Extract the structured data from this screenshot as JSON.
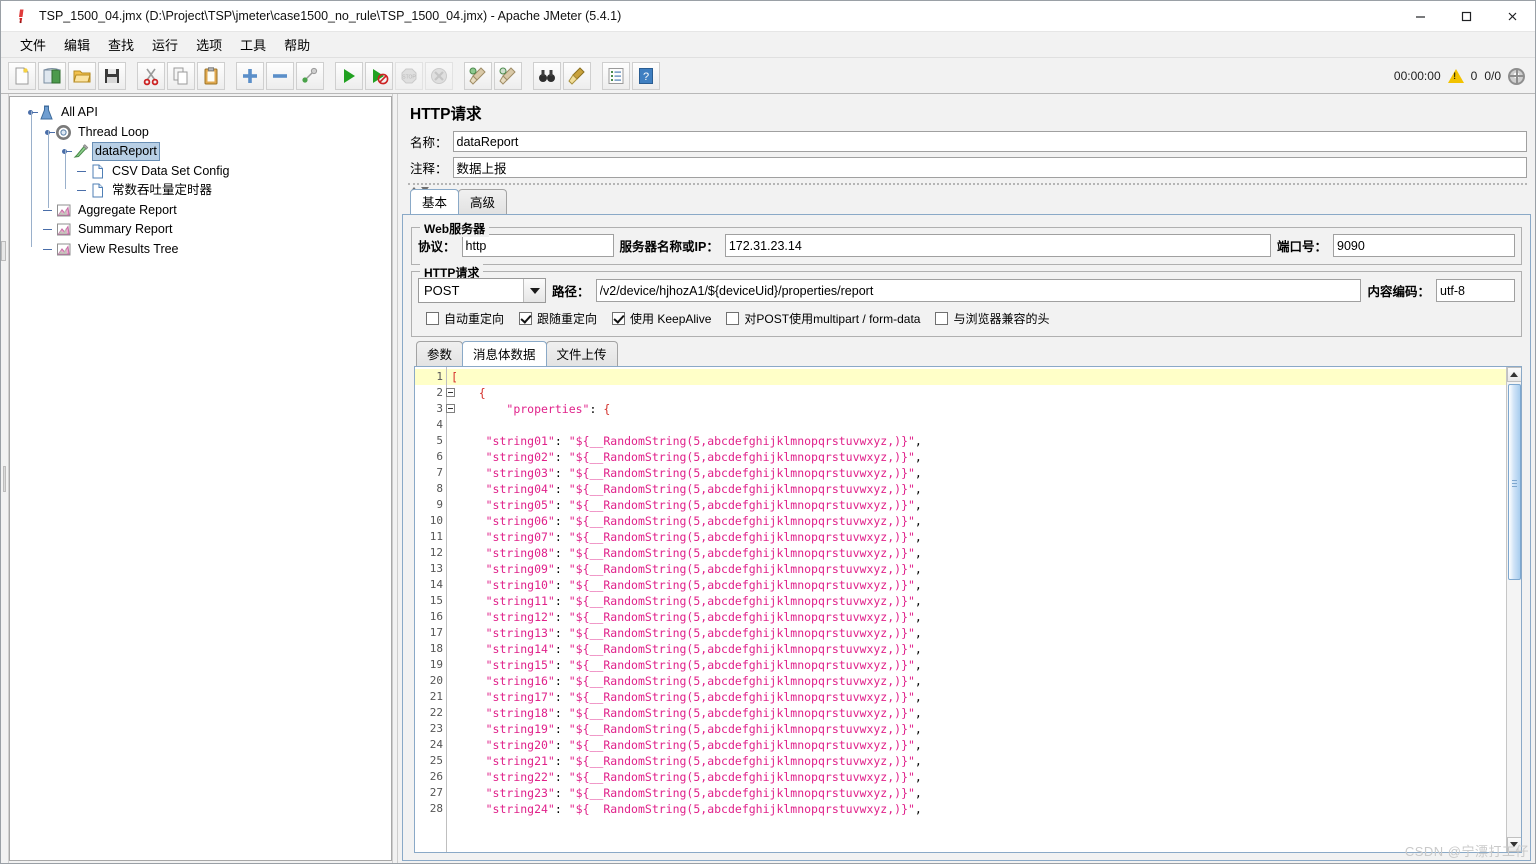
{
  "window": {
    "title": "TSP_1500_04.jmx (D:\\Project\\TSP\\jmeter\\case1500_no_rule\\TSP_1500_04.jmx) - Apache JMeter (5.4.1)",
    "minimize": "—",
    "maximize": "□",
    "close": "✕"
  },
  "menu": [
    "文件",
    "编辑",
    "查找",
    "运行",
    "选项",
    "工具",
    "帮助"
  ],
  "toolbar": {
    "buttons": [
      {
        "name": "new-button",
        "icon": "new-file-icon"
      },
      {
        "name": "templates-button",
        "icon": "templates-icon"
      },
      {
        "name": "open-button",
        "icon": "open-folder-icon"
      },
      {
        "name": "save-button",
        "icon": "save-disk-icon"
      },
      {
        "name": "cut-button",
        "icon": "scissors-icon"
      },
      {
        "name": "copy-button",
        "icon": "copy-icon"
      },
      {
        "name": "paste-button",
        "icon": "clipboard-icon"
      },
      {
        "name": "expand-all-button",
        "icon": "plus-icon"
      },
      {
        "name": "collapse-all-button",
        "icon": "minus-icon"
      },
      {
        "name": "toggle-button",
        "icon": "toggle-icon"
      },
      {
        "name": "start-button",
        "icon": "play-green-icon"
      },
      {
        "name": "start-no-pauses-button",
        "icon": "play-no-pause-icon"
      },
      {
        "name": "stop-button",
        "icon": "stop-sign-icon"
      },
      {
        "name": "shutdown-button",
        "icon": "shutdown-icon"
      },
      {
        "name": "clear-button",
        "icon": "broom-icon"
      },
      {
        "name": "clear-all-button",
        "icon": "broom-all-icon"
      },
      {
        "name": "search-button",
        "icon": "binoculars-icon"
      },
      {
        "name": "reset-search-button",
        "icon": "reset-broom-icon"
      },
      {
        "name": "function-helper-button",
        "icon": "function-list-icon"
      },
      {
        "name": "help-button",
        "icon": "help-book-icon"
      }
    ],
    "elapsed_time": "00:00:00",
    "warning_count": "0",
    "threads_count": "0/0"
  },
  "tree": {
    "nodes": [
      {
        "label": "All API",
        "icon": "test-plan-icon",
        "depth": 0,
        "selected": false,
        "has_handle": true
      },
      {
        "label": "Thread Loop",
        "icon": "thread-group-icon",
        "depth": 1,
        "selected": false,
        "has_handle": true
      },
      {
        "label": "dataReport",
        "icon": "http-sampler-icon",
        "depth": 2,
        "selected": true,
        "has_handle": true
      },
      {
        "label": "CSV Data Set Config",
        "icon": "config-element-icon",
        "depth": 3,
        "selected": false,
        "has_handle": false
      },
      {
        "label": "常数吞吐量定时器",
        "icon": "timer-icon",
        "depth": 3,
        "selected": false,
        "has_handle": false
      },
      {
        "label": "Aggregate Report",
        "icon": "listener-icon",
        "depth": 1,
        "selected": false,
        "has_handle": false
      },
      {
        "label": "Summary Report",
        "icon": "listener-icon",
        "depth": 1,
        "selected": false,
        "has_handle": false
      },
      {
        "label": "View Results Tree",
        "icon": "listener-icon",
        "depth": 1,
        "selected": false,
        "has_handle": false
      }
    ]
  },
  "panel": {
    "title": "HTTP请求",
    "name_label": "名称：",
    "name_value": "dataReport",
    "comment_label": "注释：",
    "comment_value": "数据上报",
    "tabs": [
      {
        "label": "基本",
        "active": true
      },
      {
        "label": "高级",
        "active": false
      }
    ],
    "web_server": {
      "group_title": "Web服务器",
      "protocol_label": "协议：",
      "protocol_value": "http",
      "server_label": "服务器名称或IP：",
      "server_value": "172.31.23.14",
      "port_label": "端口号：",
      "port_value": "9090"
    },
    "http_request": {
      "group_title": "HTTP请求",
      "method_value": "POST",
      "path_label": "路径：",
      "path_value": "/v2/device/hjhozA1/${deviceUid}/properties/report",
      "encoding_label": "内容编码：",
      "encoding_value": "utf-8",
      "checkboxes": [
        {
          "label": "自动重定向",
          "checked": false
        },
        {
          "label": "跟随重定向",
          "checked": true
        },
        {
          "label": "使用 KeepAlive",
          "checked": true
        },
        {
          "label": "对POST使用multipart / form-data",
          "checked": false
        },
        {
          "label": "与浏览器兼容的头",
          "checked": false
        }
      ]
    },
    "body_tabs": [
      {
        "label": "参数",
        "active": false
      },
      {
        "label": "消息体数据",
        "active": true
      },
      {
        "label": "文件上传",
        "active": false
      }
    ]
  },
  "editor": {
    "lines": [
      {
        "num": "1",
        "text": "[",
        "style": "red",
        "highlight": true,
        "fold": false
      },
      {
        "num": "2",
        "text": "    {",
        "style": "red",
        "highlight": false,
        "fold": true
      },
      {
        "num": "3",
        "text": "        \"properties\": {",
        "style": "mixed",
        "highlight": false,
        "fold": true
      },
      {
        "num": "4",
        "text": "",
        "style": "plain",
        "highlight": false,
        "fold": false
      },
      {
        "num": "5",
        "text": "     \"string01\": \"${__RandomString(5,abcdefghijklmnopqrstuvwxyz,)}\",",
        "style": "pink",
        "highlight": false,
        "fold": false
      },
      {
        "num": "6",
        "text": "     \"string02\": \"${__RandomString(5,abcdefghijklmnopqrstuvwxyz,)}\",",
        "style": "pink",
        "highlight": false,
        "fold": false
      },
      {
        "num": "7",
        "text": "     \"string03\": \"${__RandomString(5,abcdefghijklmnopqrstuvwxyz,)}\",",
        "style": "pink",
        "highlight": false,
        "fold": false
      },
      {
        "num": "8",
        "text": "     \"string04\": \"${__RandomString(5,abcdefghijklmnopqrstuvwxyz,)}\",",
        "style": "pink",
        "highlight": false,
        "fold": false
      },
      {
        "num": "9",
        "text": "     \"string05\": \"${__RandomString(5,abcdefghijklmnopqrstuvwxyz,)}\",",
        "style": "pink",
        "highlight": false,
        "fold": false
      },
      {
        "num": "10",
        "text": "     \"string06\": \"${__RandomString(5,abcdefghijklmnopqrstuvwxyz,)}\",",
        "style": "pink",
        "highlight": false,
        "fold": false
      },
      {
        "num": "11",
        "text": "     \"string07\": \"${__RandomString(5,abcdefghijklmnopqrstuvwxyz,)}\",",
        "style": "pink",
        "highlight": false,
        "fold": false
      },
      {
        "num": "12",
        "text": "     \"string08\": \"${__RandomString(5,abcdefghijklmnopqrstuvwxyz,)}\",",
        "style": "pink",
        "highlight": false,
        "fold": false
      },
      {
        "num": "13",
        "text": "     \"string09\": \"${__RandomString(5,abcdefghijklmnopqrstuvwxyz,)}\",",
        "style": "pink",
        "highlight": false,
        "fold": false
      },
      {
        "num": "14",
        "text": "     \"string10\": \"${__RandomString(5,abcdefghijklmnopqrstuvwxyz,)}\",",
        "style": "pink",
        "highlight": false,
        "fold": false
      },
      {
        "num": "15",
        "text": "     \"string11\": \"${__RandomString(5,abcdefghijklmnopqrstuvwxyz,)}\",",
        "style": "pink",
        "highlight": false,
        "fold": false
      },
      {
        "num": "16",
        "text": "     \"string12\": \"${__RandomString(5,abcdefghijklmnopqrstuvwxyz,)}\",",
        "style": "pink",
        "highlight": false,
        "fold": false
      },
      {
        "num": "17",
        "text": "     \"string13\": \"${__RandomString(5,abcdefghijklmnopqrstuvwxyz,)}\",",
        "style": "pink",
        "highlight": false,
        "fold": false
      },
      {
        "num": "18",
        "text": "     \"string14\": \"${__RandomString(5,abcdefghijklmnopqrstuvwxyz,)}\",",
        "style": "pink",
        "highlight": false,
        "fold": false
      },
      {
        "num": "19",
        "text": "     \"string15\": \"${__RandomString(5,abcdefghijklmnopqrstuvwxyz,)}\",",
        "style": "pink",
        "highlight": false,
        "fold": false
      },
      {
        "num": "20",
        "text": "     \"string16\": \"${__RandomString(5,abcdefghijklmnopqrstuvwxyz,)}\",",
        "style": "pink",
        "highlight": false,
        "fold": false
      },
      {
        "num": "21",
        "text": "     \"string17\": \"${__RandomString(5,abcdefghijklmnopqrstuvwxyz,)}\",",
        "style": "pink",
        "highlight": false,
        "fold": false
      },
      {
        "num": "22",
        "text": "     \"string18\": \"${__RandomString(5,abcdefghijklmnopqrstuvwxyz,)}\",",
        "style": "pink",
        "highlight": false,
        "fold": false
      },
      {
        "num": "23",
        "text": "     \"string19\": \"${__RandomString(5,abcdefghijklmnopqrstuvwxyz,)}\",",
        "style": "pink",
        "highlight": false,
        "fold": false
      },
      {
        "num": "24",
        "text": "     \"string20\": \"${__RandomString(5,abcdefghijklmnopqrstuvwxyz,)}\",",
        "style": "pink",
        "highlight": false,
        "fold": false
      },
      {
        "num": "25",
        "text": "     \"string21\": \"${__RandomString(5,abcdefghijklmnopqrstuvwxyz,)}\",",
        "style": "pink",
        "highlight": false,
        "fold": false
      },
      {
        "num": "26",
        "text": "     \"string22\": \"${__RandomString(5,abcdefghijklmnopqrstuvwxyz,)}\",",
        "style": "pink",
        "highlight": false,
        "fold": false
      },
      {
        "num": "27",
        "text": "     \"string23\": \"${__RandomString(5,abcdefghijklmnopqrstuvwxyz,)}\",",
        "style": "pink",
        "highlight": false,
        "fold": false
      },
      {
        "num": "28",
        "text": "     \"string24\": \"${  RandomString(5,abcdefghijklmnopqrstuvwxyz,)}\",",
        "style": "pink",
        "highlight": false,
        "fold": false
      }
    ]
  },
  "watermark": "CSDN @宁漂打工仔",
  "colors": {
    "accent": "#b8cfe5",
    "string": "#e0218a",
    "bracket": "#d4302b",
    "highlight_line": "#ffffc8"
  }
}
